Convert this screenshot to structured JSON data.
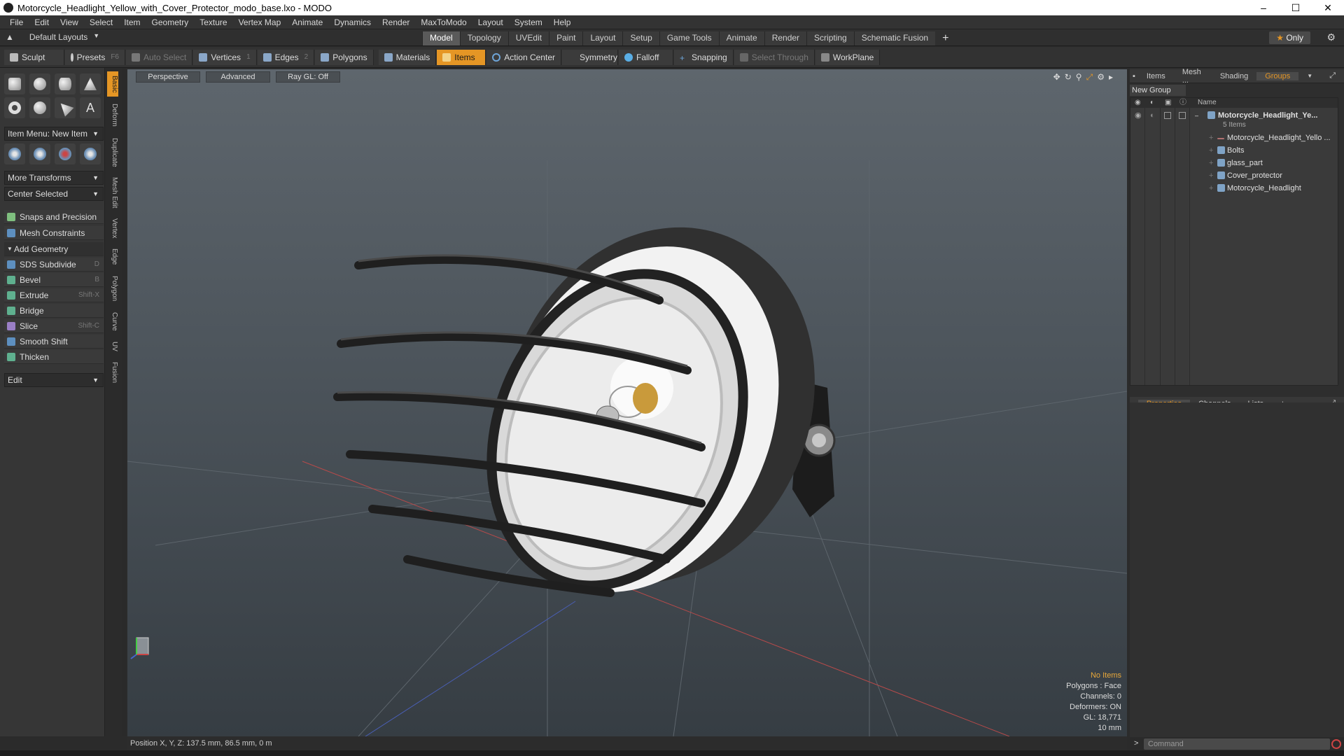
{
  "window": {
    "title": "Motorcycle_Headlight_Yellow_with_Cover_Protector_modo_base.lxo - MODO"
  },
  "menu": [
    "File",
    "Edit",
    "View",
    "Select",
    "Item",
    "Geometry",
    "Texture",
    "Vertex Map",
    "Animate",
    "Dynamics",
    "Render",
    "MaxToModo",
    "Layout",
    "System",
    "Help"
  ],
  "layout": {
    "name": "Default Layouts"
  },
  "modes": [
    "Model",
    "Topology",
    "UVEdit",
    "Paint",
    "Layout",
    "Setup",
    "Game Tools",
    "Animate",
    "Render",
    "Scripting",
    "Schematic Fusion"
  ],
  "only_label": "Only",
  "toolbar": {
    "sculpt": "Sculpt",
    "presets": "Presets",
    "presets_hk": "F6",
    "auto_select": "Auto Select",
    "vertices": "Vertices",
    "vertices_hk": "1",
    "edges": "Edges",
    "edges_hk": "2",
    "polygons": "Polygons",
    "materials": "Materials",
    "items": "Items",
    "action_center": "Action Center",
    "symmetry": "Symmetry",
    "falloff": "Falloff",
    "snapping": "Snapping",
    "select_through": "Select Through",
    "workplane": "WorkPlane"
  },
  "left": {
    "item_menu": "Item Menu: New Item",
    "more_transforms": "More Transforms",
    "center_selected": "Center Selected",
    "snaps": "Snaps and Precision",
    "mesh_constraints": "Mesh Constraints",
    "add_geometry": "Add Geometry",
    "tools": [
      {
        "label": "SDS Subdivide",
        "hk": "D"
      },
      {
        "label": "Bevel",
        "hk": "B"
      },
      {
        "label": "Extrude",
        "hk": "Shift-X"
      },
      {
        "label": "Bridge",
        "hk": ""
      },
      {
        "label": "Slice",
        "hk": "Shift-C"
      },
      {
        "label": "Smooth Shift",
        "hk": ""
      },
      {
        "label": "Thicken",
        "hk": ""
      }
    ],
    "edit": "Edit"
  },
  "vtabs": [
    "Basic",
    "Deform",
    "Duplicate",
    "Mesh Edit",
    "Vertex",
    "Edge",
    "Polygon",
    "Curve",
    "UV",
    "Fusion"
  ],
  "viewport": {
    "view": "Perspective",
    "shading": "Advanced",
    "raygl": "Ray GL: Off",
    "info": {
      "items": "No Items",
      "polygons": "Polygons : Face",
      "channels": "Channels: 0",
      "deformers": "Deformers: ON",
      "gl": "GL: 18,771",
      "scale": "10 mm"
    }
  },
  "status": {
    "position": "Position X, Y, Z:   137.5 mm, 86.5 mm, 0 m"
  },
  "right": {
    "tabs": [
      "Items",
      "Mesh ...",
      "Shading",
      "Groups"
    ],
    "new_group": "New Group",
    "name_col": "Name",
    "group_name": "Motorcycle_Headlight_Ye...",
    "group_count": "5 Items",
    "children": [
      "Motorcycle_Headlight_Yello ...",
      "Bolts",
      "glass_part",
      "Cover_protector",
      "Motorcycle_Headlight"
    ],
    "prop_tabs": [
      "Properties",
      "Channels",
      "Lists"
    ],
    "command_placeholder": "Command"
  }
}
